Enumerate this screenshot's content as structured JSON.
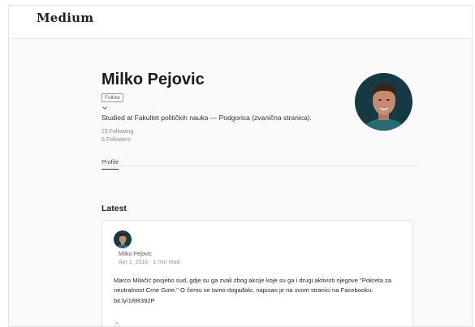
{
  "header": {
    "brand": "Medium"
  },
  "profile": {
    "name": "Milko Pejovic",
    "follow_label": "Follow",
    "bio": "Studied at Fakultet političkih nauka — Podgorica (zvanična stranica).",
    "following": "23 Following",
    "followers": "6 Followers",
    "tabs": [
      {
        "label": "Profile"
      }
    ]
  },
  "latest": {
    "title": "Latest",
    "post": {
      "author": "Milko Pejovic",
      "date": "Apr 1, 2016",
      "separator": "·",
      "read_time": "1 min read",
      "text": "Marco Milačić posjetio sud, gdje su ga zvali zbog akcije koje su ga i drugi aktivisti njegove \"Pokreta za neutralnost Crne Gore.\" O čemu se tamo događalo, napisao je na svom stranici na Facebooku.",
      "link": "bit.ly/1RR392P"
    }
  },
  "colors": {
    "background": "#fafafa",
    "card": "#ffffff",
    "text": "#222222",
    "muted": "#8c8c8c"
  }
}
